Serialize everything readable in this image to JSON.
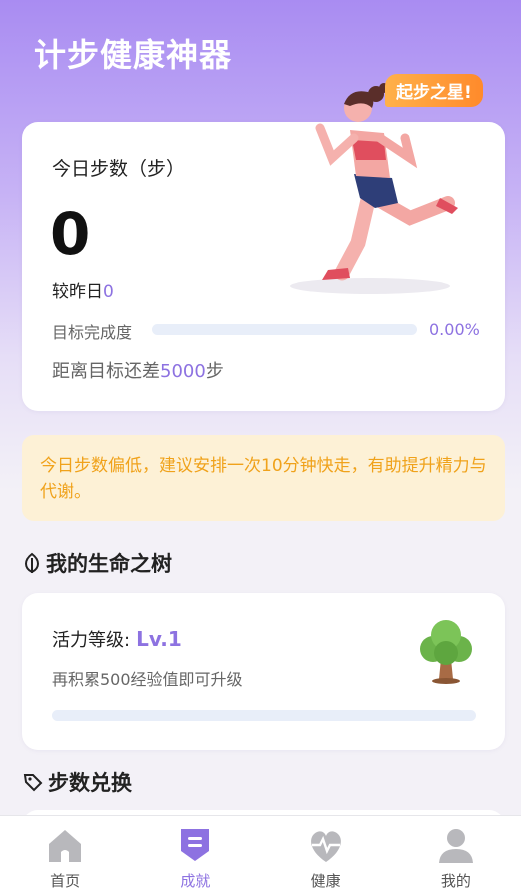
{
  "header": {
    "title": "计步健康神器",
    "badge": "起步之星!"
  },
  "today": {
    "label": "今日步数（步）",
    "steps": "0",
    "compare_label": "较昨日",
    "compare_value": "0",
    "goal_label": "目标完成度",
    "goal_percent_text": "0.00%",
    "goal_fraction": 0,
    "remaining_prefix": "距离目标还差",
    "remaining_value": "5000",
    "remaining_suffix": "步"
  },
  "tip": {
    "text": "今日步数偏低，建议安排一次10分钟快走，有助提升精力与代谢。"
  },
  "tree_section": {
    "title": "我的生命之树",
    "vitality_label": "活力等级:",
    "level": "Lv.1",
    "hint": "再积累500经验值即可升级",
    "progress_fraction": 0,
    "icon": "tree-icon"
  },
  "exchange_section": {
    "title": "步数兑换"
  },
  "tabs": [
    {
      "label": "首页",
      "icon": "home-icon",
      "active": false
    },
    {
      "label": "成就",
      "icon": "achievement-icon",
      "active": true
    },
    {
      "label": "健康",
      "icon": "heart-icon",
      "active": false
    },
    {
      "label": "我的",
      "icon": "user-icon",
      "active": false
    }
  ],
  "colors": {
    "accent": "#8d72e1",
    "badge": "#ff9a36",
    "tip_text": "#f0a21b",
    "tip_bg": "#fdf1d6"
  }
}
